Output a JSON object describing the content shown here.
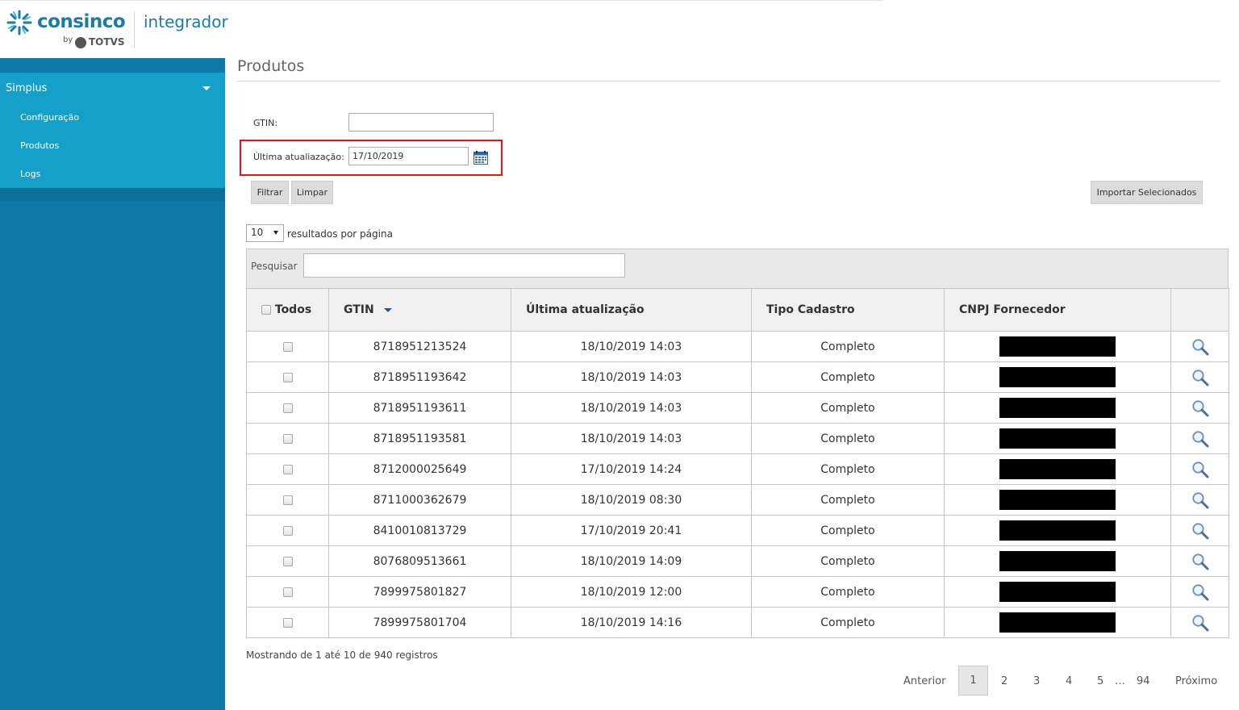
{
  "header": {
    "brand": "consinco",
    "by": "by",
    "totvs": "TOTVS",
    "product": "integrador"
  },
  "sidebar": {
    "group": "Simplus",
    "items": [
      "Configuração",
      "Produtos",
      "Logs"
    ]
  },
  "page": {
    "title": "Produtos"
  },
  "filters": {
    "gtin_label": "GTIN:",
    "gtin_value": "",
    "date_label": "Última atualiazação:",
    "date_value": "17/10/2019",
    "filter_button": "Filtrar",
    "clear_button": "Limpar",
    "import_button": "Importar Selecionados"
  },
  "listing": {
    "page_size": "10",
    "page_size_label": "resultados por página",
    "search_label": "Pesquisar",
    "search_value": ""
  },
  "table": {
    "columns": [
      "Todos",
      "GTIN",
      "Última atualização",
      "Tipo Cadastro",
      "CNPJ Fornecedor"
    ],
    "rows": [
      {
        "gtin": "8718951213524",
        "updated": "18/10/2019 14:03",
        "tipo": "Completo"
      },
      {
        "gtin": "8718951193642",
        "updated": "18/10/2019 14:03",
        "tipo": "Completo"
      },
      {
        "gtin": "8718951193611",
        "updated": "18/10/2019 14:03",
        "tipo": "Completo"
      },
      {
        "gtin": "8718951193581",
        "updated": "18/10/2019 14:03",
        "tipo": "Completo"
      },
      {
        "gtin": "8712000025649",
        "updated": "17/10/2019 14:24",
        "tipo": "Completo"
      },
      {
        "gtin": "8711000362679",
        "updated": "18/10/2019 08:30",
        "tipo": "Completo"
      },
      {
        "gtin": "8410010813729",
        "updated": "17/10/2019 20:41",
        "tipo": "Completo"
      },
      {
        "gtin": "8076809513661",
        "updated": "18/10/2019 14:09",
        "tipo": "Completo"
      },
      {
        "gtin": "7899975801827",
        "updated": "18/10/2019 12:00",
        "tipo": "Completo"
      },
      {
        "gtin": "7899975801704",
        "updated": "18/10/2019 14:16",
        "tipo": "Completo"
      }
    ]
  },
  "footer": {
    "info": "Mostrando de 1 até 10 de 940 registros",
    "prev": "Anterior",
    "current": "1",
    "pages": [
      "2",
      "3",
      "4",
      "5"
    ],
    "ellipsis": "…",
    "last": "94",
    "next": "Próximo"
  },
  "colors": {
    "sidebar": "#0f79a7",
    "sidebar_panel": "#14a0c9",
    "brand": "#1d7aa3",
    "highlight": "#e0141d"
  },
  "icons": [
    "consinco-star-logo",
    "totvs-logo",
    "calendar-icon",
    "caret-down-icon",
    "sort-desc-icon",
    "magnifier-icon"
  ]
}
